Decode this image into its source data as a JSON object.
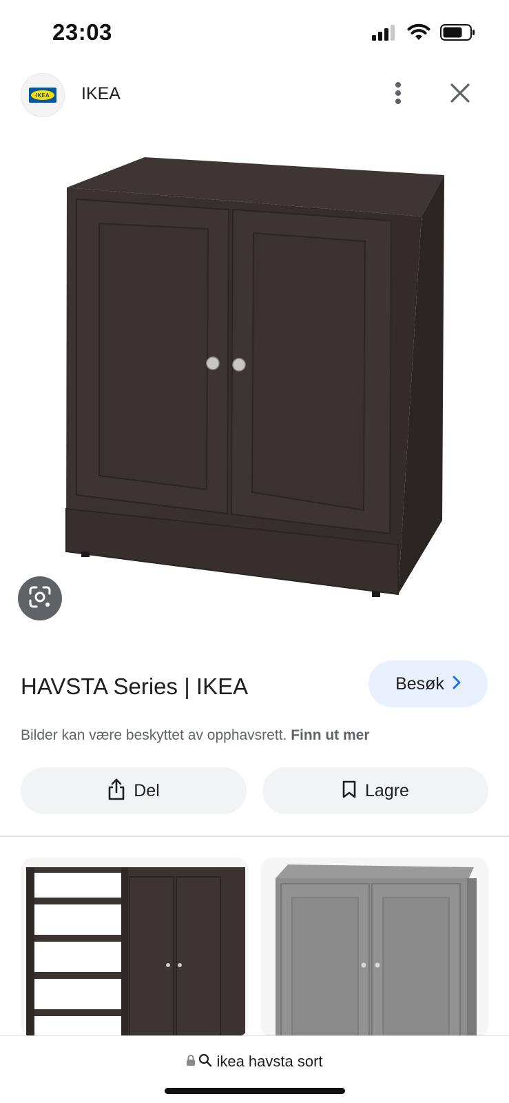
{
  "status_bar": {
    "time": "23:03",
    "icons": [
      "cellular-signal-icon",
      "wifi-icon",
      "battery-icon"
    ]
  },
  "header": {
    "site_name": "IKEA",
    "logo_text": "IKEA",
    "icons": [
      "ikea-logo-icon",
      "more-vert-icon",
      "close-icon"
    ]
  },
  "image": {
    "subject": "dark brown two-door cabinet",
    "lens_icon": "google-lens-icon"
  },
  "result": {
    "title": "HAVSTA Series | IKEA",
    "visit_label": "Besøk",
    "visit_icon": "chevron-right-icon"
  },
  "copyright": {
    "text": "Bilder kan være beskyttet av opphavsrett.",
    "link": "Finn ut mer"
  },
  "actions": {
    "share_label": "Del",
    "share_icon": "share-icon",
    "save_label": "Lagre",
    "save_icon": "bookmark-icon"
  },
  "related": [
    {
      "subject": "dark brown cabinet with open shelves"
    },
    {
      "subject": "grey two-door cabinet"
    }
  ],
  "bottom_bar": {
    "url_text": "ikea havsta sort",
    "icons": [
      "lock-icon",
      "search-icon"
    ]
  },
  "colors": {
    "visit_button_bg": "#e8f0fe",
    "action_button_bg": "#f1f3f4",
    "lens_button_bg": "#5f6368",
    "cabinet_dark": "#3b3432",
    "cabinet_grey": "#8d8d8d"
  }
}
